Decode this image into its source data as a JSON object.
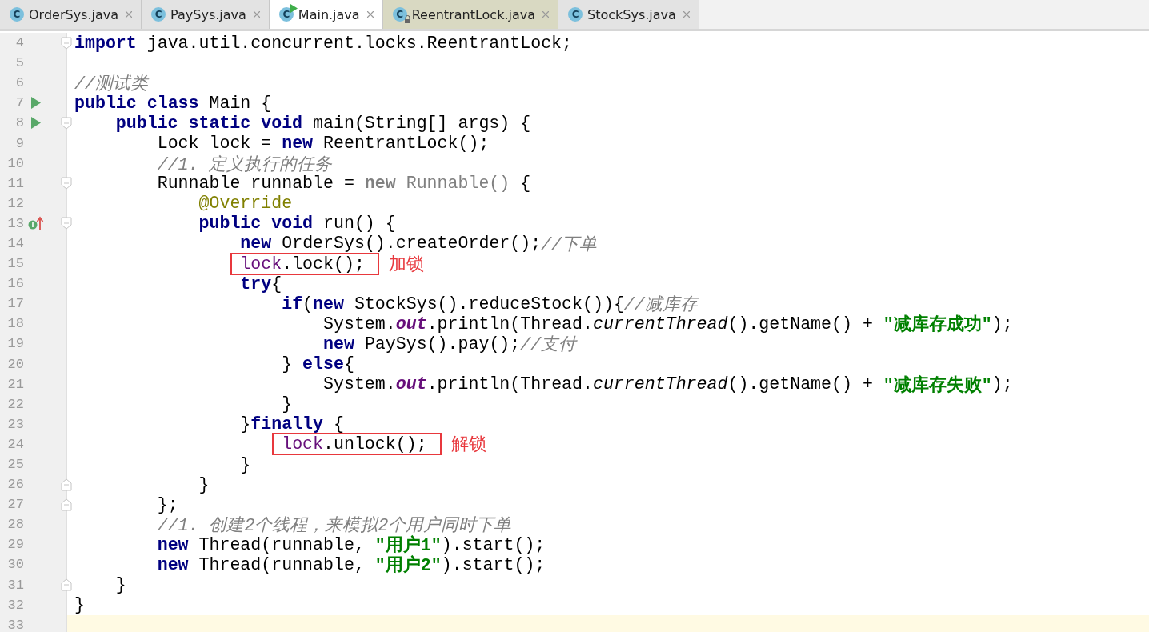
{
  "tabs": [
    {
      "label": "OrderSys.java",
      "icon_letter": "C",
      "selected": false,
      "readonly": false,
      "runnable": false
    },
    {
      "label": "PaySys.java",
      "icon_letter": "C",
      "selected": false,
      "readonly": false,
      "runnable": false
    },
    {
      "label": "Main.java",
      "icon_letter": "C",
      "selected": true,
      "readonly": false,
      "runnable": true
    },
    {
      "label": "ReentrantLock.java",
      "icon_letter": "C",
      "selected": false,
      "readonly": true,
      "runnable": false
    },
    {
      "label": "StockSys.java",
      "icon_letter": "C",
      "selected": false,
      "readonly": false,
      "runnable": false
    }
  ],
  "lines": [
    {
      "number": "4",
      "fold_start": true,
      "tokens": [
        {
          "t": "import",
          "kind": "kw"
        },
        {
          "t": " java.util.concurrent.locks.ReentrantLock;",
          "kind": "plain"
        }
      ]
    },
    {
      "number": "5"
    },
    {
      "number": "6",
      "tokens": [
        {
          "t": "//测试类",
          "kind": "comment"
        }
      ]
    },
    {
      "number": "7",
      "run_marker": true,
      "tokens": [
        {
          "t": "public class",
          "kind": "kw"
        },
        {
          "t": " Main {",
          "kind": "plain"
        }
      ],
      "children": [
        {
          "number": "8",
          "run_marker": true,
          "fold_start": true,
          "tokens": [
            {
              "t": "public static void",
              "kind": "kw"
            },
            {
              "t": " main(String[] args) {",
              "kind": "plain"
            }
          ],
          "children": [
            {
              "number": "9",
              "tokens": [
                {
                  "t": "Lock lock = ",
                  "kind": "plain"
                },
                {
                  "t": "new",
                  "kind": "kw"
                },
                {
                  "t": " ReentrantLock();",
                  "kind": "plain"
                }
              ]
            },
            {
              "number": "10",
              "tokens": [
                {
                  "t": "//1. 定义执行的任务",
                  "kind": "comment"
                }
              ]
            },
            {
              "number": "11",
              "fold_start": true,
              "tokens": [
                {
                  "t": "Runnable runnable = ",
                  "kind": "plain"
                },
                {
                  "t": "new",
                  "kind": "dimkw"
                },
                {
                  "t": " Runnable()",
                  "kind": "dim"
                },
                {
                  "t": " {",
                  "kind": "plain"
                }
              ],
              "children": [
                {
                  "number": "12",
                  "tokens": [
                    {
                      "t": "@Override",
                      "kind": "annotation"
                    }
                  ]
                },
                {
                  "number": "13",
                  "implements_marker": true,
                  "fold_start": true,
                  "tokens": [
                    {
                      "t": "public void",
                      "kind": "kw"
                    },
                    {
                      "t": " run() {",
                      "kind": "plain"
                    }
                  ],
                  "children": [
                    {
                      "number": "14",
                      "tokens": [
                        {
                          "t": "new",
                          "kind": "kw"
                        },
                        {
                          "t": " OrderSys().createOrder();",
                          "kind": "plain"
                        },
                        {
                          "t": "//下单",
                          "kind": "comment"
                        }
                      ]
                    },
                    {
                      "number": "15",
                      "callout": "加锁",
                      "tokens": [
                        {
                          "t": "lock",
                          "kind": "local"
                        },
                        {
                          "t": ".lock();",
                          "kind": "plain"
                        }
                      ]
                    },
                    {
                      "number": "16",
                      "tokens": [
                        {
                          "t": "try",
                          "kind": "kw"
                        },
                        {
                          "t": "{",
                          "kind": "plain"
                        }
                      ],
                      "children": [
                        {
                          "number": "17",
                          "tokens": [
                            {
                              "t": "if",
                              "kind": "kw"
                            },
                            {
                              "t": "(",
                              "kind": "plain"
                            },
                            {
                              "t": "new",
                              "kind": "kw"
                            },
                            {
                              "t": " StockSys().reduceStock()){",
                              "kind": "plain"
                            },
                            {
                              "t": "//减库存",
                              "kind": "comment"
                            }
                          ],
                          "children": [
                            {
                              "number": "18",
                              "tokens": [
                                {
                                  "t": "System.",
                                  "kind": "plain"
                                },
                                {
                                  "t": "out",
                                  "kind": "field"
                                },
                                {
                                  "t": ".println(Thread.",
                                  "kind": "plain"
                                },
                                {
                                  "t": "currentThread",
                                  "kind": "static"
                                },
                                {
                                  "t": "().getName() + ",
                                  "kind": "plain"
                                },
                                {
                                  "t": "\"减库存成功\"",
                                  "kind": "string"
                                },
                                {
                                  "t": ");",
                                  "kind": "plain"
                                }
                              ]
                            },
                            {
                              "number": "19",
                              "tokens": [
                                {
                                  "t": "new",
                                  "kind": "kw"
                                },
                                {
                                  "t": " PaySys().pay();",
                                  "kind": "plain"
                                },
                                {
                                  "t": "//支付",
                                  "kind": "comment"
                                }
                              ]
                            }
                          ]
                        },
                        {
                          "number": "20",
                          "tokens": [
                            {
                              "t": "} ",
                              "kind": "plain"
                            },
                            {
                              "t": "else",
                              "kind": "kw"
                            },
                            {
                              "t": "{",
                              "kind": "plain"
                            }
                          ],
                          "children": [
                            {
                              "number": "21",
                              "tokens": [
                                {
                                  "t": "System.",
                                  "kind": "plain"
                                },
                                {
                                  "t": "out",
                                  "kind": "field"
                                },
                                {
                                  "t": ".println(Thread.",
                                  "kind": "plain"
                                },
                                {
                                  "t": "currentThread",
                                  "kind": "static"
                                },
                                {
                                  "t": "().getName() + ",
                                  "kind": "plain"
                                },
                                {
                                  "t": "\"减库存失败\"",
                                  "kind": "string"
                                },
                                {
                                  "t": ");",
                                  "kind": "plain"
                                }
                              ]
                            }
                          ]
                        },
                        {
                          "number": "22",
                          "tokens": [
                            {
                              "t": "}",
                              "kind": "plain"
                            }
                          ]
                        }
                      ]
                    },
                    {
                      "number": "23",
                      "tokens": [
                        {
                          "t": "}",
                          "kind": "plain"
                        },
                        {
                          "t": "finally",
                          "kind": "kw"
                        },
                        {
                          "t": " {",
                          "kind": "plain"
                        }
                      ],
                      "children": [
                        {
                          "number": "24",
                          "callout": "解锁",
                          "tokens": [
                            {
                              "t": "lock",
                              "kind": "local"
                            },
                            {
                              "t": ".unlock();",
                              "kind": "plain"
                            }
                          ]
                        }
                      ]
                    },
                    {
                      "number": "25",
                      "tokens": [
                        {
                          "t": "}",
                          "kind": "plain"
                        }
                      ]
                    }
                  ]
                },
                {
                  "number": "26",
                  "fold_end": true,
                  "tokens": [
                    {
                      "t": "}",
                      "kind": "plain"
                    }
                  ]
                }
              ]
            },
            {
              "number": "27",
              "fold_end": true,
              "tokens": [
                {
                  "t": "};",
                  "kind": "plain"
                }
              ]
            },
            {
              "number": "28",
              "tokens": [
                {
                  "t": "//1. 创建2个线程，来模拟2个用户同时下单",
                  "kind": "comment"
                }
              ]
            },
            {
              "number": "29",
              "tokens": [
                {
                  "t": "new",
                  "kind": "kw"
                },
                {
                  "t": " Thread(runnable, ",
                  "kind": "plain"
                },
                {
                  "t": "\"用户1\"",
                  "kind": "string"
                },
                {
                  "t": ").start();",
                  "kind": "plain"
                }
              ]
            },
            {
              "number": "30",
              "tokens": [
                {
                  "t": "new",
                  "kind": "kw"
                },
                {
                  "t": " Thread(runnable, ",
                  "kind": "plain"
                },
                {
                  "t": "\"用户2\"",
                  "kind": "string"
                },
                {
                  "t": ").start();",
                  "kind": "plain"
                }
              ]
            }
          ]
        },
        {
          "number": "31",
          "fold_end": true,
          "tokens": [
            {
              "t": "}",
              "kind": "plain"
            }
          ]
        }
      ]
    },
    {
      "number": "32",
      "tokens": [
        {
          "t": "}",
          "kind": "plain"
        }
      ]
    },
    {
      "number": "33",
      "current": true
    }
  ]
}
